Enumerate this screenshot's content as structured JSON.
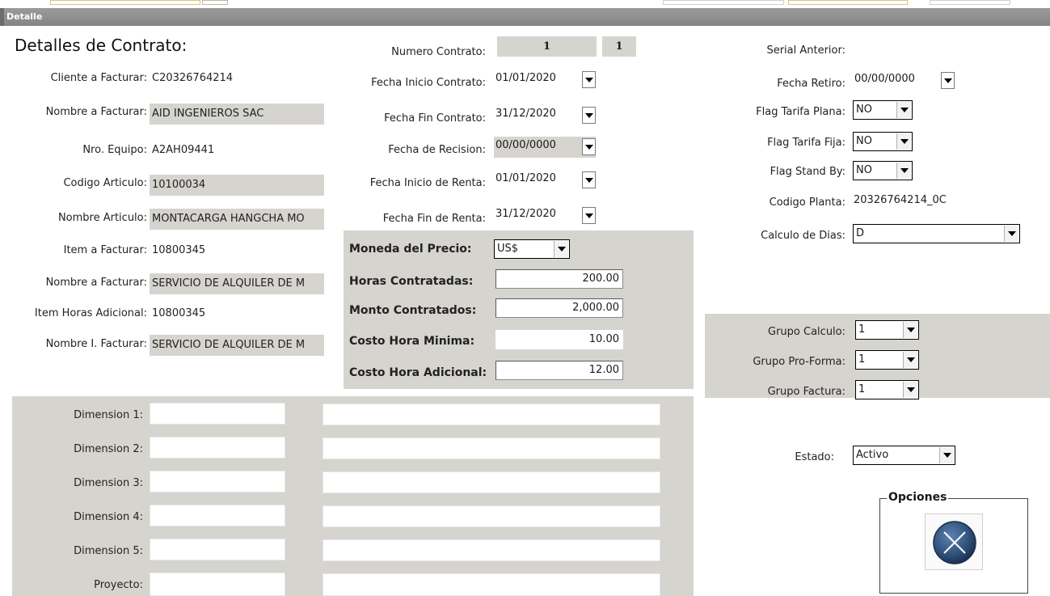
{
  "window": {
    "title": "Detalle"
  },
  "header": {
    "title": "Detalles de Contrato:"
  },
  "left": {
    "cliente_label": "Cliente a Facturar:",
    "cliente_value": "C20326764214",
    "nombre_facturar_label": "Nombre a Facturar:",
    "nombre_facturar_value": "AID INGENIEROS SAC",
    "nro_equipo_label": "Nro. Equipo:",
    "nro_equipo_value": "A2AH09441",
    "codigo_articulo_label": "Codigo Articulo:",
    "codigo_articulo_value": "10100034",
    "nombre_articulo_label": "Nombre Articulo:",
    "nombre_articulo_value": "MONTACARGA HANGCHA MO",
    "item_facturar_label": "Item a Facturar:",
    "item_facturar_value": "10800345",
    "nombre_facturar2_label": "Nombre a Facturar:",
    "nombre_facturar2_value": "SERVICIO DE ALQUILER DE M",
    "item_horas_label": "Item Horas Adicional:",
    "item_horas_value": "10800345",
    "nombre_i_label": "Nombre I. Facturar:",
    "nombre_i_value": "SERVICIO DE ALQUILER DE M"
  },
  "middle": {
    "numero_contrato_label": "Numero Contrato:",
    "numero_contrato_value": "1",
    "numero_contrato_value2": "1",
    "fecha_inicio_label": "Fecha Inicio Contrato:",
    "fecha_inicio_value": "01/01/2020",
    "fecha_fin_label": "Fecha Fin Contrato:",
    "fecha_fin_value": "31/12/2020",
    "fecha_recision_label": "Fecha de Recision:",
    "fecha_recision_value": "00/00/0000",
    "fecha_inicio_renta_label": "Fecha Inicio de Renta:",
    "fecha_inicio_renta_value": "01/01/2020",
    "fecha_fin_renta_label": "Fecha Fin de Renta:",
    "fecha_fin_renta_value": "31/12/2020",
    "moneda_label": "Moneda del Precio:",
    "moneda_value": "US$",
    "horas_label": "Horas Contratadas:",
    "horas_value": "200.00",
    "monto_label": "Monto Contratados:",
    "monto_value": "2,000.00",
    "costo_min_label": "Costo Hora Minima:",
    "costo_min_value": "10.00",
    "costo_adic_label": "Costo Hora Adicional:",
    "costo_adic_value": "12.00"
  },
  "right": {
    "serial_label": "Serial Anterior:",
    "fecha_retiro_label": "Fecha Retiro:",
    "fecha_retiro_value": "00/00/0000",
    "tarifa_plana_label": "Flag Tarifa Plana:",
    "tarifa_plana_value": "NO",
    "tarifa_fija_label": "Flag Tarifa Fija:",
    "tarifa_fija_value": "NO",
    "stand_by_label": "Flag Stand By:",
    "stand_by_value": "NO",
    "codigo_planta_label": "Codigo Planta:",
    "codigo_planta_value": "20326764214_0C",
    "calculo_dias_label": "Calculo de Dias:",
    "calculo_dias_value": "D",
    "grupo_calculo_label": "Grupo Calculo:",
    "grupo_calculo_value": "1",
    "grupo_proforma_label": "Grupo Pro-Forma:",
    "grupo_proforma_value": "1",
    "grupo_factura_label": "Grupo Factura:",
    "grupo_factura_value": "1",
    "estado_label": "Estado:",
    "estado_value": "Activo",
    "opciones_label": "Opciones"
  },
  "dimensions": [
    {
      "label": "Dimension 1:"
    },
    {
      "label": "Dimension 2:"
    },
    {
      "label": "Dimension 3:"
    },
    {
      "label": "Dimension 4:"
    },
    {
      "label": "Dimension 5:"
    },
    {
      "label": "Proyecto:"
    }
  ],
  "icons": {
    "close": "close-circle-icon",
    "dropdown": "chevron-down-icon"
  },
  "colors": {
    "panel": "#d6d4cf",
    "titlebar": "#8e8e8e",
    "close_button": "#2e4f78"
  }
}
